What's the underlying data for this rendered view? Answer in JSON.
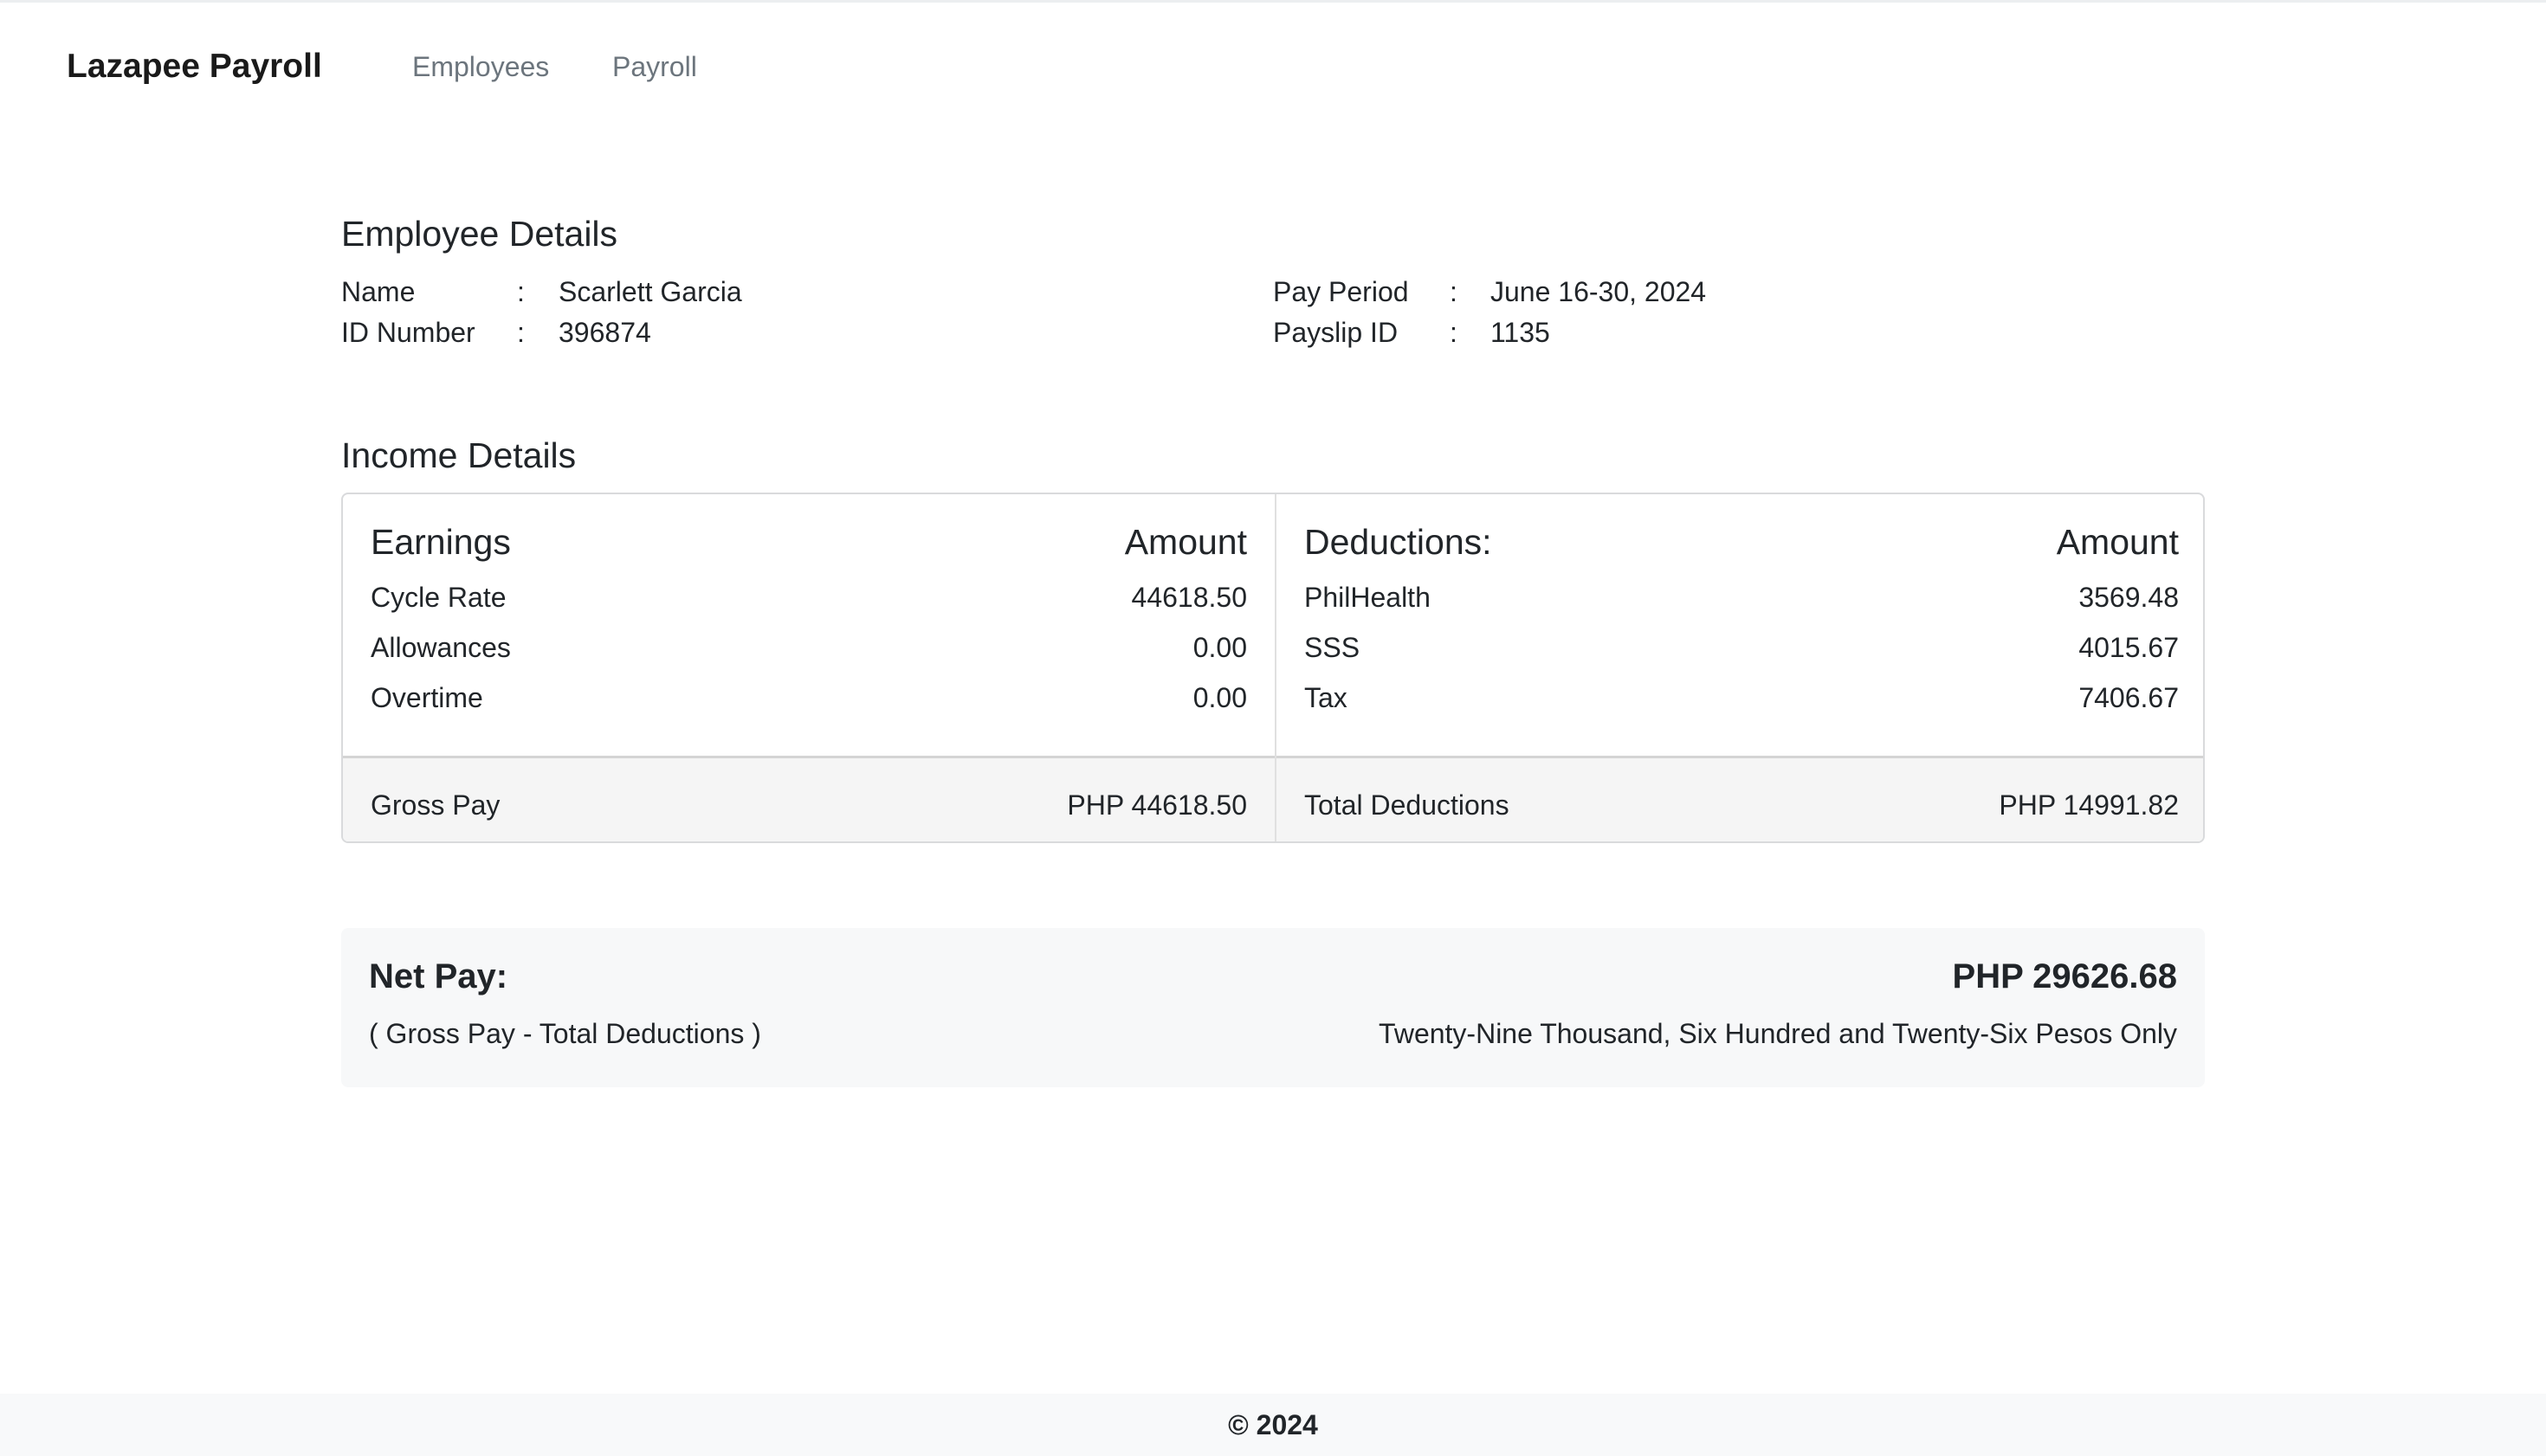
{
  "nav": {
    "brand": "Lazapee Payroll",
    "links": [
      "Employees",
      "Payroll"
    ]
  },
  "employee": {
    "title": "Employee Details",
    "name_label": "Name",
    "name": "Scarlett Garcia",
    "id_label": "ID Number",
    "id": "396874",
    "period_label": "Pay Period",
    "period": "June 16-30, 2024",
    "payslip_label": "Payslip ID",
    "payslip": "1135",
    "colon": ":"
  },
  "income": {
    "title": "Income Details",
    "earnings": {
      "header": "Earnings",
      "amount_header": "Amount",
      "rows": [
        {
          "label": "Cycle Rate",
          "value": "44618.50"
        },
        {
          "label": "Allowances",
          "value": "0.00"
        },
        {
          "label": "Overtime",
          "value": "0.00"
        }
      ],
      "total_label": "Gross Pay",
      "total": "PHP 44618.50"
    },
    "deductions": {
      "header": "Deductions:",
      "amount_header": "Amount",
      "rows": [
        {
          "label": "PhilHealth",
          "value": "3569.48"
        },
        {
          "label": "SSS",
          "value": "4015.67"
        },
        {
          "label": "Tax",
          "value": "7406.67"
        }
      ],
      "total_label": "Total Deductions",
      "total": "PHP 14991.82"
    }
  },
  "net": {
    "label": "Net Pay:",
    "formula": "( Gross Pay - Total Deductions )",
    "amount": "PHP 29626.68",
    "words": "Twenty-Nine Thousand, Six Hundred and Twenty-Six Pesos Only"
  },
  "footer": {
    "text": "© 2024"
  }
}
